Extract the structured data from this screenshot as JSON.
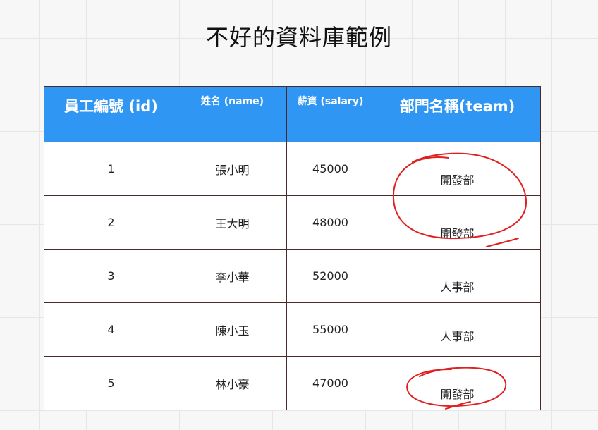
{
  "title": "不好的資料庫範例",
  "table": {
    "headers": [
      "員工編號 (id)",
      "姓名 (name)",
      "薪資 (salary)",
      "部門名稱(team)"
    ],
    "rows": [
      [
        "1",
        "張小明",
        "45000",
        "開發部"
      ],
      [
        "2",
        "王大明",
        "48000",
        "開發部"
      ],
      [
        "3",
        "李小華",
        "52000",
        "人事部"
      ],
      [
        "4",
        "陳小玉",
        "55000",
        "人事部"
      ],
      [
        "5",
        "林小豪",
        "47000",
        "開發部"
      ]
    ]
  },
  "colors": {
    "header_bg": "#2f96f3",
    "header_text": "#ffffff",
    "border": "#4a2a2a",
    "annotation": "#e02020"
  }
}
